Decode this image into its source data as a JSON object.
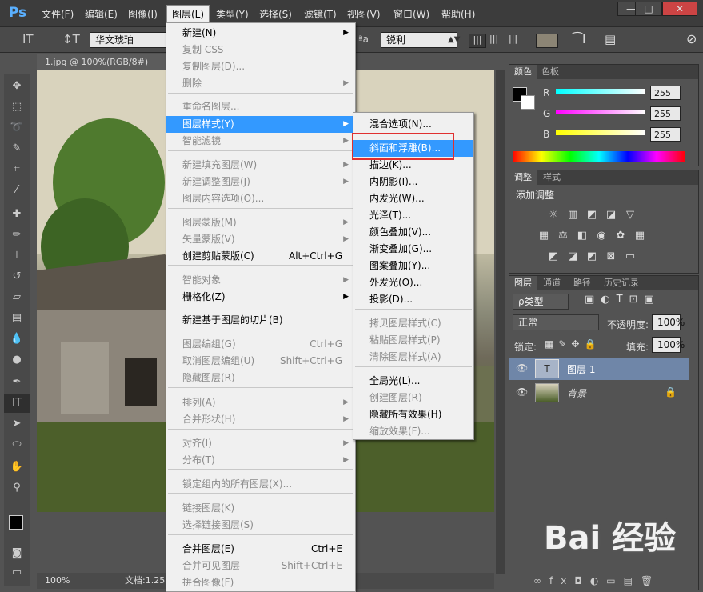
{
  "app": {
    "logo": "Ps"
  },
  "menubar": [
    "文件(F)",
    "编辑(E)",
    "图像(I)",
    "图层(L)",
    "类型(Y)",
    "选择(S)",
    "滤镜(T)",
    "视图(V)",
    "窗口(W)",
    "帮助(H)"
  ],
  "window_buttons": [
    "—",
    "□",
    "✕"
  ],
  "options": {
    "font": "华文琥珀",
    "aa_label": "ªa",
    "aa_value": "锐利"
  },
  "document": {
    "tab": "1.jpg @ 100%(RGB/8#)",
    "zoom": "100%",
    "doc_info": "文档:1.25"
  },
  "layer_menu": [
    {
      "label": "新建(N)",
      "arrow": true
    },
    {
      "label": "复制 CSS",
      "disabled": true
    },
    {
      "label": "复制图层(D)...",
      "disabled": true
    },
    {
      "label": "删除",
      "arrow": true,
      "disabled": true
    },
    {
      "label": "重命名图层...",
      "disabled": true
    },
    {
      "label": "图层样式(Y)",
      "arrow": true,
      "highlight": true
    },
    {
      "label": "智能滤镜",
      "arrow": true,
      "disabled": true
    },
    {
      "label": "新建填充图层(W)",
      "arrow": true,
      "disabled": true
    },
    {
      "label": "新建调整图层(J)",
      "arrow": true,
      "disabled": true
    },
    {
      "label": "图层内容选项(O)...",
      "disabled": true
    },
    {
      "label": "图层蒙版(M)",
      "arrow": true,
      "disabled": true
    },
    {
      "label": "矢量蒙版(V)",
      "arrow": true,
      "disabled": true
    },
    {
      "label": "创建剪贴蒙版(C)",
      "shortcut": "Alt+Ctrl+G"
    },
    {
      "label": "智能对象",
      "arrow": true,
      "disabled": true
    },
    {
      "label": "栅格化(Z)",
      "arrow": true
    },
    {
      "label": "新建基于图层的切片(B)"
    },
    {
      "label": "图层编组(G)",
      "shortcut": "Ctrl+G",
      "disabled": true
    },
    {
      "label": "取消图层编组(U)",
      "shortcut": "Shift+Ctrl+G",
      "disabled": true
    },
    {
      "label": "隐藏图层(R)",
      "disabled": true
    },
    {
      "label": "排列(A)",
      "arrow": true,
      "disabled": true
    },
    {
      "label": "合并形状(H)",
      "arrow": true,
      "disabled": true
    },
    {
      "label": "对齐(I)",
      "arrow": true,
      "disabled": true
    },
    {
      "label": "分布(T)",
      "arrow": true,
      "disabled": true
    },
    {
      "label": "锁定组内的所有图层(X)...",
      "disabled": true
    },
    {
      "label": "链接图层(K)",
      "disabled": true
    },
    {
      "label": "选择链接图层(S)",
      "disabled": true
    },
    {
      "label": "合并图层(E)",
      "shortcut": "Ctrl+E"
    },
    {
      "label": "合并可见图层",
      "shortcut": "Shift+Ctrl+E",
      "disabled": true
    },
    {
      "label": "拼合图像(F)",
      "disabled": true
    }
  ],
  "style_menu": [
    {
      "label": "混合选项(N)..."
    },
    {
      "label": "斜面和浮雕(B)...",
      "highlight": true
    },
    {
      "label": "描边(K)..."
    },
    {
      "label": "内阴影(I)..."
    },
    {
      "label": "内发光(W)..."
    },
    {
      "label": "光泽(T)..."
    },
    {
      "label": "颜色叠加(V)..."
    },
    {
      "label": "渐变叠加(G)..."
    },
    {
      "label": "图案叠加(Y)..."
    },
    {
      "label": "外发光(O)..."
    },
    {
      "label": "投影(D)..."
    },
    {
      "label": "拷贝图层样式(C)",
      "disabled": true
    },
    {
      "label": "粘贴图层样式(P)",
      "disabled": true
    },
    {
      "label": "清除图层样式(A)",
      "disabled": true
    },
    {
      "label": "全局光(L)..."
    },
    {
      "label": "创建图层(R)",
      "disabled": true
    },
    {
      "label": "隐藏所有效果(H)"
    },
    {
      "label": "缩放效果(F)...",
      "disabled": true
    }
  ],
  "color_panel": {
    "tabs": [
      "颜色",
      "色板"
    ],
    "channels": [
      {
        "name": "R",
        "value": "255"
      },
      {
        "name": "G",
        "value": "255"
      },
      {
        "name": "B",
        "value": "255"
      }
    ]
  },
  "adjust_panel": {
    "tabs": [
      "调整",
      "样式"
    ],
    "title": "添加调整"
  },
  "layers_panel": {
    "tabs": [
      "图层",
      "通道",
      "路径",
      "历史记录"
    ],
    "filter": "ρ类型",
    "blend": "正常",
    "opacity_label": "不透明度:",
    "opacity": "100%",
    "lock_label": "锁定:",
    "fill_label": "填充:",
    "fill": "100%",
    "layers": [
      {
        "name": "图层 1",
        "selected": true
      },
      {
        "name": "背景",
        "locked": true
      }
    ]
  },
  "watermark": "Bai 经验"
}
